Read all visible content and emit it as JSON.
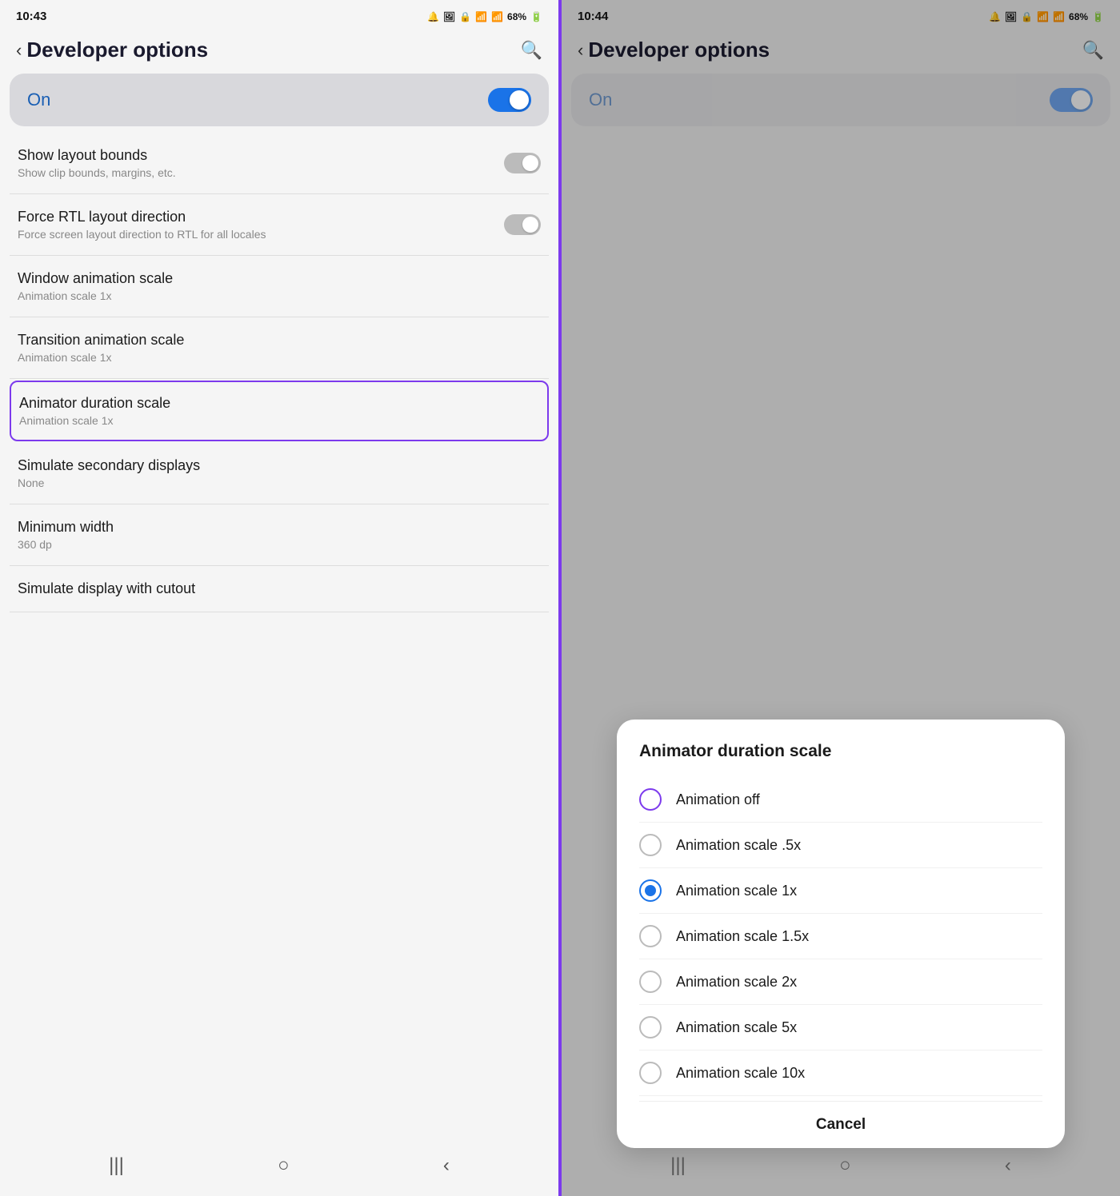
{
  "left": {
    "statusBar": {
      "time": "10:43",
      "battery": "68%"
    },
    "header": {
      "back": "‹",
      "title": "Developer options",
      "search": "🔍"
    },
    "onToggle": {
      "label": "On"
    },
    "settings": [
      {
        "title": "Show layout bounds",
        "subtitle": "Show clip bounds, margins, etc.",
        "hasToggle": true,
        "highlighted": false
      },
      {
        "title": "Force RTL layout direction",
        "subtitle": "Force screen layout direction to RTL for all locales",
        "hasToggle": true,
        "highlighted": false
      },
      {
        "title": "Window animation scale",
        "subtitle": "Animation scale 1x",
        "hasToggle": false,
        "highlighted": false
      },
      {
        "title": "Transition animation scale",
        "subtitle": "Animation scale 1x",
        "hasToggle": false,
        "highlighted": false
      },
      {
        "title": "Animator duration scale",
        "subtitle": "Animation scale 1x",
        "hasToggle": false,
        "highlighted": true
      },
      {
        "title": "Simulate secondary displays",
        "subtitle": "None",
        "hasToggle": false,
        "highlighted": false
      },
      {
        "title": "Minimum width",
        "subtitle": "360 dp",
        "hasToggle": false,
        "highlighted": false
      },
      {
        "title": "Simulate display with cutout",
        "subtitle": "",
        "hasToggle": false,
        "highlighted": false
      }
    ]
  },
  "right": {
    "statusBar": {
      "time": "10:44",
      "battery": "68%"
    },
    "header": {
      "back": "‹",
      "title": "Developer options",
      "search": "🔍"
    },
    "onToggle": {
      "label": "On"
    },
    "dialog": {
      "title": "Animator duration scale",
      "options": [
        {
          "label": "Animation off",
          "selected": false,
          "highlighted": true
        },
        {
          "label": "Animation scale .5x",
          "selected": false,
          "highlighted": false
        },
        {
          "label": "Animation scale 1x",
          "selected": true,
          "highlighted": false
        },
        {
          "label": "Animation scale 1.5x",
          "selected": false,
          "highlighted": false
        },
        {
          "label": "Animation scale 2x",
          "selected": false,
          "highlighted": false
        },
        {
          "label": "Animation scale 5x",
          "selected": false,
          "highlighted": false
        },
        {
          "label": "Animation scale 10x",
          "selected": false,
          "highlighted": false
        }
      ],
      "cancelLabel": "Cancel"
    }
  },
  "nav": {
    "recents": "|||",
    "home": "○",
    "back": "‹"
  }
}
